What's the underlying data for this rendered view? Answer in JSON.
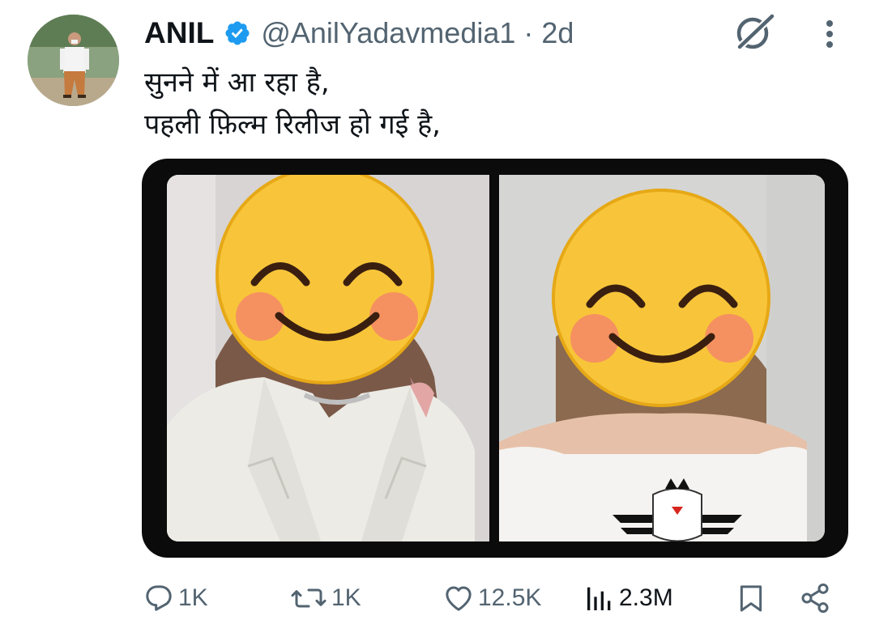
{
  "user": {
    "name": "ANIL",
    "handle": "@AnilYadavmedia1",
    "separator": "·",
    "time": "2d"
  },
  "tweet": {
    "lines": [
      "सुनने में आ रहा है,",
      "पहली फ़िल्म रिलीज हो गई है,"
    ]
  },
  "actions": {
    "replies": "1K",
    "reposts": "1K",
    "likes": "12.5K",
    "views": "2.3M"
  },
  "icons": {
    "verified": "verified-badge-icon",
    "grok": "grok-icon",
    "more": "more-vertical-icon",
    "reply": "reply-icon",
    "repost": "repost-icon",
    "like": "heart-icon",
    "views": "views-chart-icon",
    "bookmark": "bookmark-icon",
    "share": "share-icon"
  },
  "colors": {
    "verified": "#1d9bf0",
    "text": "#0f1419",
    "secondary": "#536471",
    "media_border": "#0b0b0b",
    "emoji_face": "#f8c53a"
  }
}
